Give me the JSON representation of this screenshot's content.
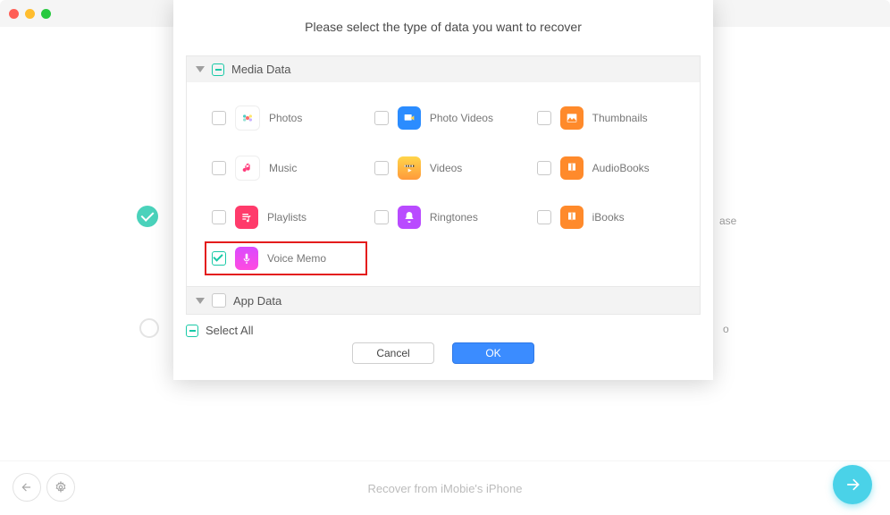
{
  "dialog": {
    "title": "Please select the type of data you want to recover",
    "sections": {
      "media": {
        "label": "Media Data"
      },
      "app": {
        "label": "App Data"
      }
    },
    "items": {
      "photos": "Photos",
      "photo_videos": "Photo Videos",
      "thumbnails": "Thumbnails",
      "music": "Music",
      "videos": "Videos",
      "audiobooks": "AudioBooks",
      "playlists": "Playlists",
      "ringtones": "Ringtones",
      "ibooks": "iBooks",
      "voice_memo": "Voice Memo"
    },
    "select_all": "Select All",
    "cancel": "Cancel",
    "ok": "OK"
  },
  "background": {
    "text_ase": "ase",
    "text_o": "o"
  },
  "footer": {
    "caption": "Recover from iMobie's iPhone"
  },
  "icons": {
    "close": "close-icon",
    "minimize": "minimize-icon",
    "maximize": "maximize-icon",
    "back": "back-arrow-icon",
    "gear": "gear-icon",
    "next": "forward-arrow-icon"
  }
}
